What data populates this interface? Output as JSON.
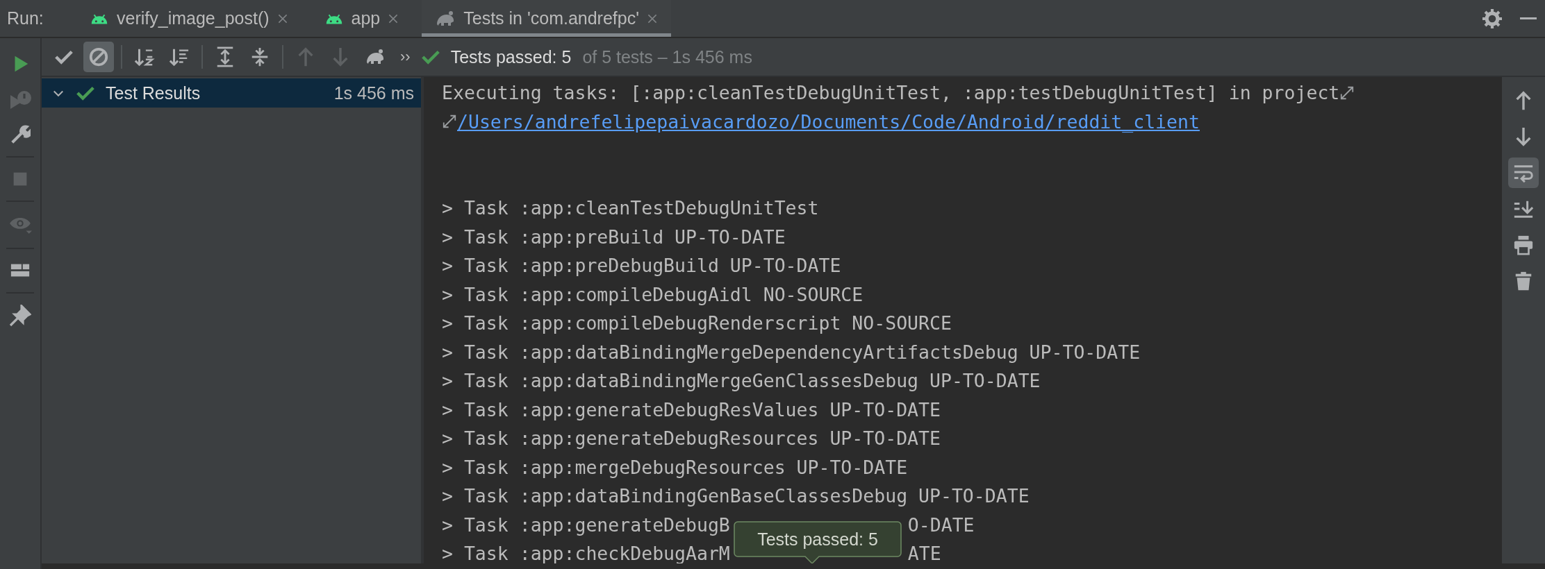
{
  "run_bar": {
    "label": "Run:",
    "tabs": [
      {
        "label": "verify_image_post()",
        "selected": false
      },
      {
        "label": "app",
        "selected": false
      },
      {
        "label": "Tests in 'com.andrefpc'",
        "selected": true
      }
    ]
  },
  "sidebar": {
    "buttons": [
      {
        "disabled": false
      },
      {
        "disabled": true
      },
      {
        "disabled": false
      },
      {
        "disabled": true
      },
      {
        "disabled": true
      },
      {
        "disabled": false
      },
      {
        "disabled": false
      }
    ]
  },
  "toolbar": {
    "buttons": [
      {
        "selected": false,
        "disabled": false
      },
      {
        "selected": true,
        "disabled": false
      },
      {
        "selected": false,
        "disabled": false
      },
      {
        "selected": false,
        "disabled": false
      },
      {
        "selected": false,
        "disabled": false
      },
      {
        "selected": false,
        "disabled": false
      },
      {
        "selected": false,
        "disabled": true
      },
      {
        "selected": false,
        "disabled": true
      },
      {
        "selected": false,
        "disabled": false
      }
    ],
    "overflow": "››",
    "status": "Tests passed: 5",
    "status_detail": "of 5 tests – 1s 456 ms"
  },
  "tree": {
    "items": [
      {
        "label": "Test Results",
        "duration": "1s 456 ms",
        "expanded": true,
        "selected": true
      }
    ]
  },
  "console": {
    "command": "Executing tasks: [:app:cleanTestDebugUnitTest, :app:testDebugUnitTest] in project",
    "project_link": "/Users/andrefelipepaivacardozo/Documents/Code/Android/reddit_client",
    "lines": [
      {
        "segments": [
          "> Task :app:cleanTestDebugUnitTest"
        ]
      },
      {
        "segments": [
          "> Task :app:preBuild UP-TO-DATE"
        ]
      },
      {
        "segments": [
          "> Task :app:preDebugBuild UP-TO-DATE"
        ]
      },
      {
        "segments": [
          "> Task :app:compileDebugAidl NO-SOURCE"
        ]
      },
      {
        "segments": [
          "> Task :app:compileDebugRenderscript NO-SOURCE"
        ]
      },
      {
        "segments": [
          "> Task :app:dataBindingMergeDependencyArtifactsDebug UP-TO-DATE"
        ]
      },
      {
        "segments": [
          "> Task :app:dataBindingMergeGenClassesDebug UP-TO-DATE"
        ]
      },
      {
        "segments": [
          "> Task :app:generateDebugResValues UP-TO-DATE"
        ]
      },
      {
        "segments": [
          "> Task :app:generateDebugResources UP-TO-DATE"
        ]
      },
      {
        "segments": [
          "> Task :app:mergeDebugResources UP-TO-DATE"
        ]
      },
      {
        "segments": [
          "> Task :app:dataBindingGenBaseClassesDebug UP-TO-DATE"
        ]
      },
      {
        "segments": [
          "> Task :app:generateDebugB",
          "O-DATE"
        ]
      },
      {
        "segments": [
          "> Task :app:checkDebugAarM",
          "ATE"
        ]
      }
    ],
    "tooltip": "Tests passed: 5"
  },
  "actions": {
    "buttons": [
      {
        "selected": false
      },
      {
        "selected": false
      },
      {
        "selected": true
      },
      {
        "selected": false
      },
      {
        "selected": false
      },
      {
        "selected": false
      }
    ]
  }
}
